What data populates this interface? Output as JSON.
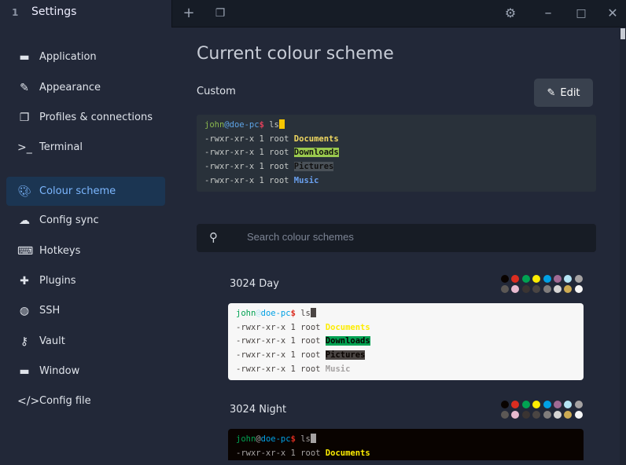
{
  "titlebar": {
    "tab_number": "1",
    "tab_title": "Settings"
  },
  "sidebar": {
    "items": [
      {
        "label": "Application",
        "icon": "window-icon"
      },
      {
        "label": "Appearance",
        "icon": "paint-icon"
      },
      {
        "label": "Profiles & connections",
        "icon": "profiles-icon"
      },
      {
        "label": "Terminal",
        "icon": "terminal-icon"
      },
      {
        "label": "Colour scheme",
        "icon": "palette-icon",
        "active": true
      },
      {
        "label": "Config sync",
        "icon": "cloud-icon"
      },
      {
        "label": "Hotkeys",
        "icon": "keyboard-icon"
      },
      {
        "label": "Plugins",
        "icon": "puzzle-icon"
      },
      {
        "label": "SSH",
        "icon": "globe-icon"
      },
      {
        "label": "Vault",
        "icon": "key-icon"
      },
      {
        "label": "Window",
        "icon": "window-icon"
      },
      {
        "label": "Config file",
        "icon": "code-icon"
      }
    ]
  },
  "main": {
    "title": "Current colour scheme",
    "current_name": "Custom",
    "edit_label": "Edit",
    "search_placeholder": "Search colour schemes",
    "preview": {
      "user": "john",
      "at": "@",
      "host": "doe-pc",
      "prompt": "$",
      "cmd": " ls",
      "perm": "-rwxr-xr-x 1 root ",
      "files": [
        "Documents",
        "Downloads",
        "Pictures",
        "Music"
      ]
    },
    "schemes": [
      {
        "name": "3024 Day"
      },
      {
        "name": "3024 Night"
      }
    ],
    "palette_3024": [
      "#090300",
      "#db2d20",
      "#01a252",
      "#fded02",
      "#01a0e4",
      "#a16a94",
      "#b5e4f4",
      "#a5a2a2",
      "#5c5855",
      "#e8bbd0",
      "#3a3432",
      "#4a4543",
      "#807d7c",
      "#d6d5d4",
      "#cdab53",
      "#f7f7f7"
    ]
  }
}
